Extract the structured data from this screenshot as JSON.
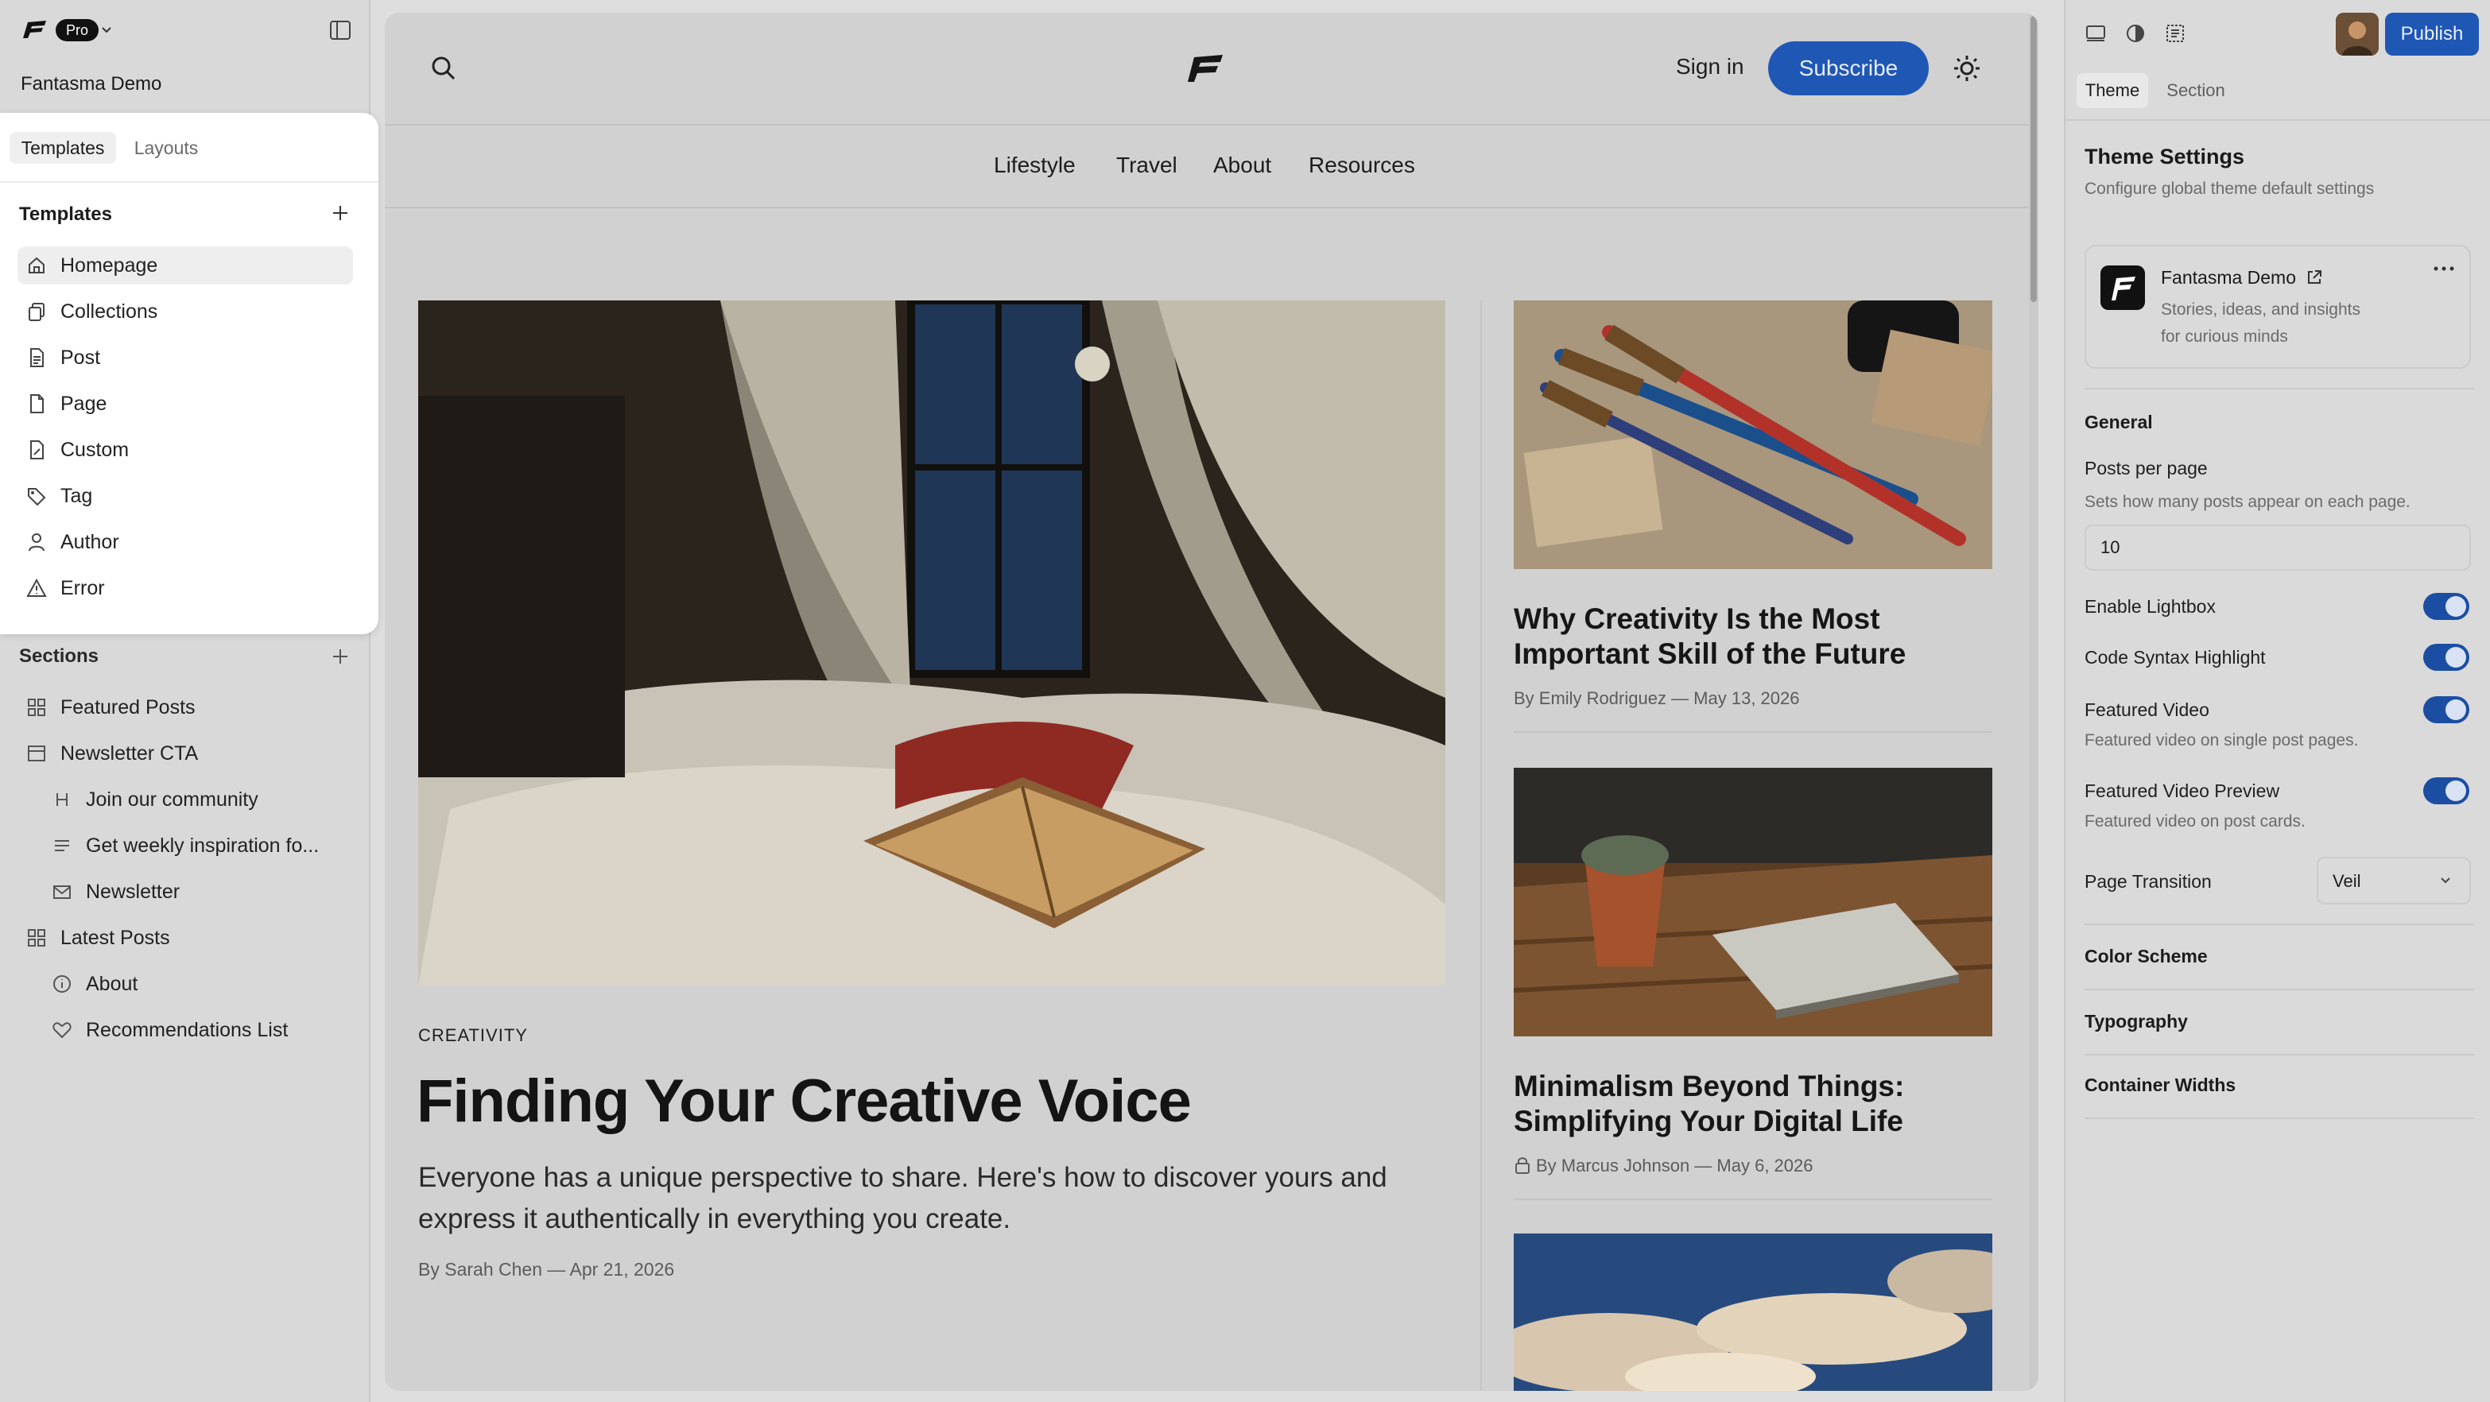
{
  "app": {
    "plan_badge": "Pro",
    "site_name": "Fantasma Demo"
  },
  "left": {
    "tabs": [
      "Templates",
      "Layouts"
    ],
    "templates_heading": "Templates",
    "templates": [
      "Homepage",
      "Collections",
      "Post",
      "Page",
      "Custom",
      "Tag",
      "Author",
      "Error"
    ],
    "sections_heading": "Sections",
    "sections": [
      {
        "label": "Featured Posts",
        "icon": "grid-icon"
      },
      {
        "label": "Newsletter CTA",
        "icon": "layout-icon"
      },
      {
        "label": "Join our community",
        "icon": "heading-icon"
      },
      {
        "label": "Get weekly inspiration fo...",
        "icon": "text-icon"
      },
      {
        "label": "Newsletter",
        "icon": "mail-icon"
      },
      {
        "label": "Latest Posts",
        "icon": "grid-icon"
      },
      {
        "label": "About",
        "icon": "info-icon"
      },
      {
        "label": "Recommendations List",
        "icon": "heart-icon"
      }
    ]
  },
  "preview": {
    "header": {
      "sign_in": "Sign in",
      "subscribe": "Subscribe"
    },
    "nav": [
      "Lifestyle",
      "Travel",
      "About",
      "Resources"
    ],
    "featured": {
      "category": "CREATIVITY",
      "title": "Finding Your Creative Voice",
      "excerpt_line1": "Everyone has a unique perspective to share. Here's how to discover yours and",
      "excerpt_line2": "express it authentically in everything you create.",
      "byline": "By Sarah Chen — Apr 21, 2026"
    },
    "side_posts": [
      {
        "title_line1": "Why Creativity Is the Most",
        "title_line2": "Important Skill of the Future",
        "byline": "By Emily Rodriguez — May 13, 2026"
      },
      {
        "title_line1": "Minimalism Beyond Things:",
        "title_line2": "Simplifying Your Digital Life",
        "byline": "By Marcus Johnson — May 6, 2026"
      }
    ]
  },
  "right": {
    "publish": "Publish",
    "tabs": [
      "Theme",
      "Section"
    ],
    "title": "Theme Settings",
    "subtitle": "Configure global theme default settings",
    "site_card": {
      "name": "Fantasma Demo",
      "desc_line1": "Stories, ideas, and insights",
      "desc_line2": "for curious minds"
    },
    "general": "General",
    "posts_per_page": {
      "label": "Posts per page",
      "desc": "Sets how many posts appear on each page.",
      "value": "10"
    },
    "toggles": [
      {
        "label": "Enable Lightbox",
        "on": true
      },
      {
        "label": "Code Syntax Highlight",
        "on": true
      },
      {
        "label": "Featured Video",
        "desc": "Featured video on single post pages.",
        "on": true
      },
      {
        "label": "Featured Video Preview",
        "desc": "Featured video on post cards.",
        "on": true
      }
    ],
    "page_transition": {
      "label": "Page Transition",
      "value": "Veil"
    },
    "groups": [
      "Color Scheme",
      "Typography",
      "Container Widths"
    ]
  },
  "colors": {
    "accent": "#1f57b5",
    "toggle_on": "#1b4ea3"
  }
}
